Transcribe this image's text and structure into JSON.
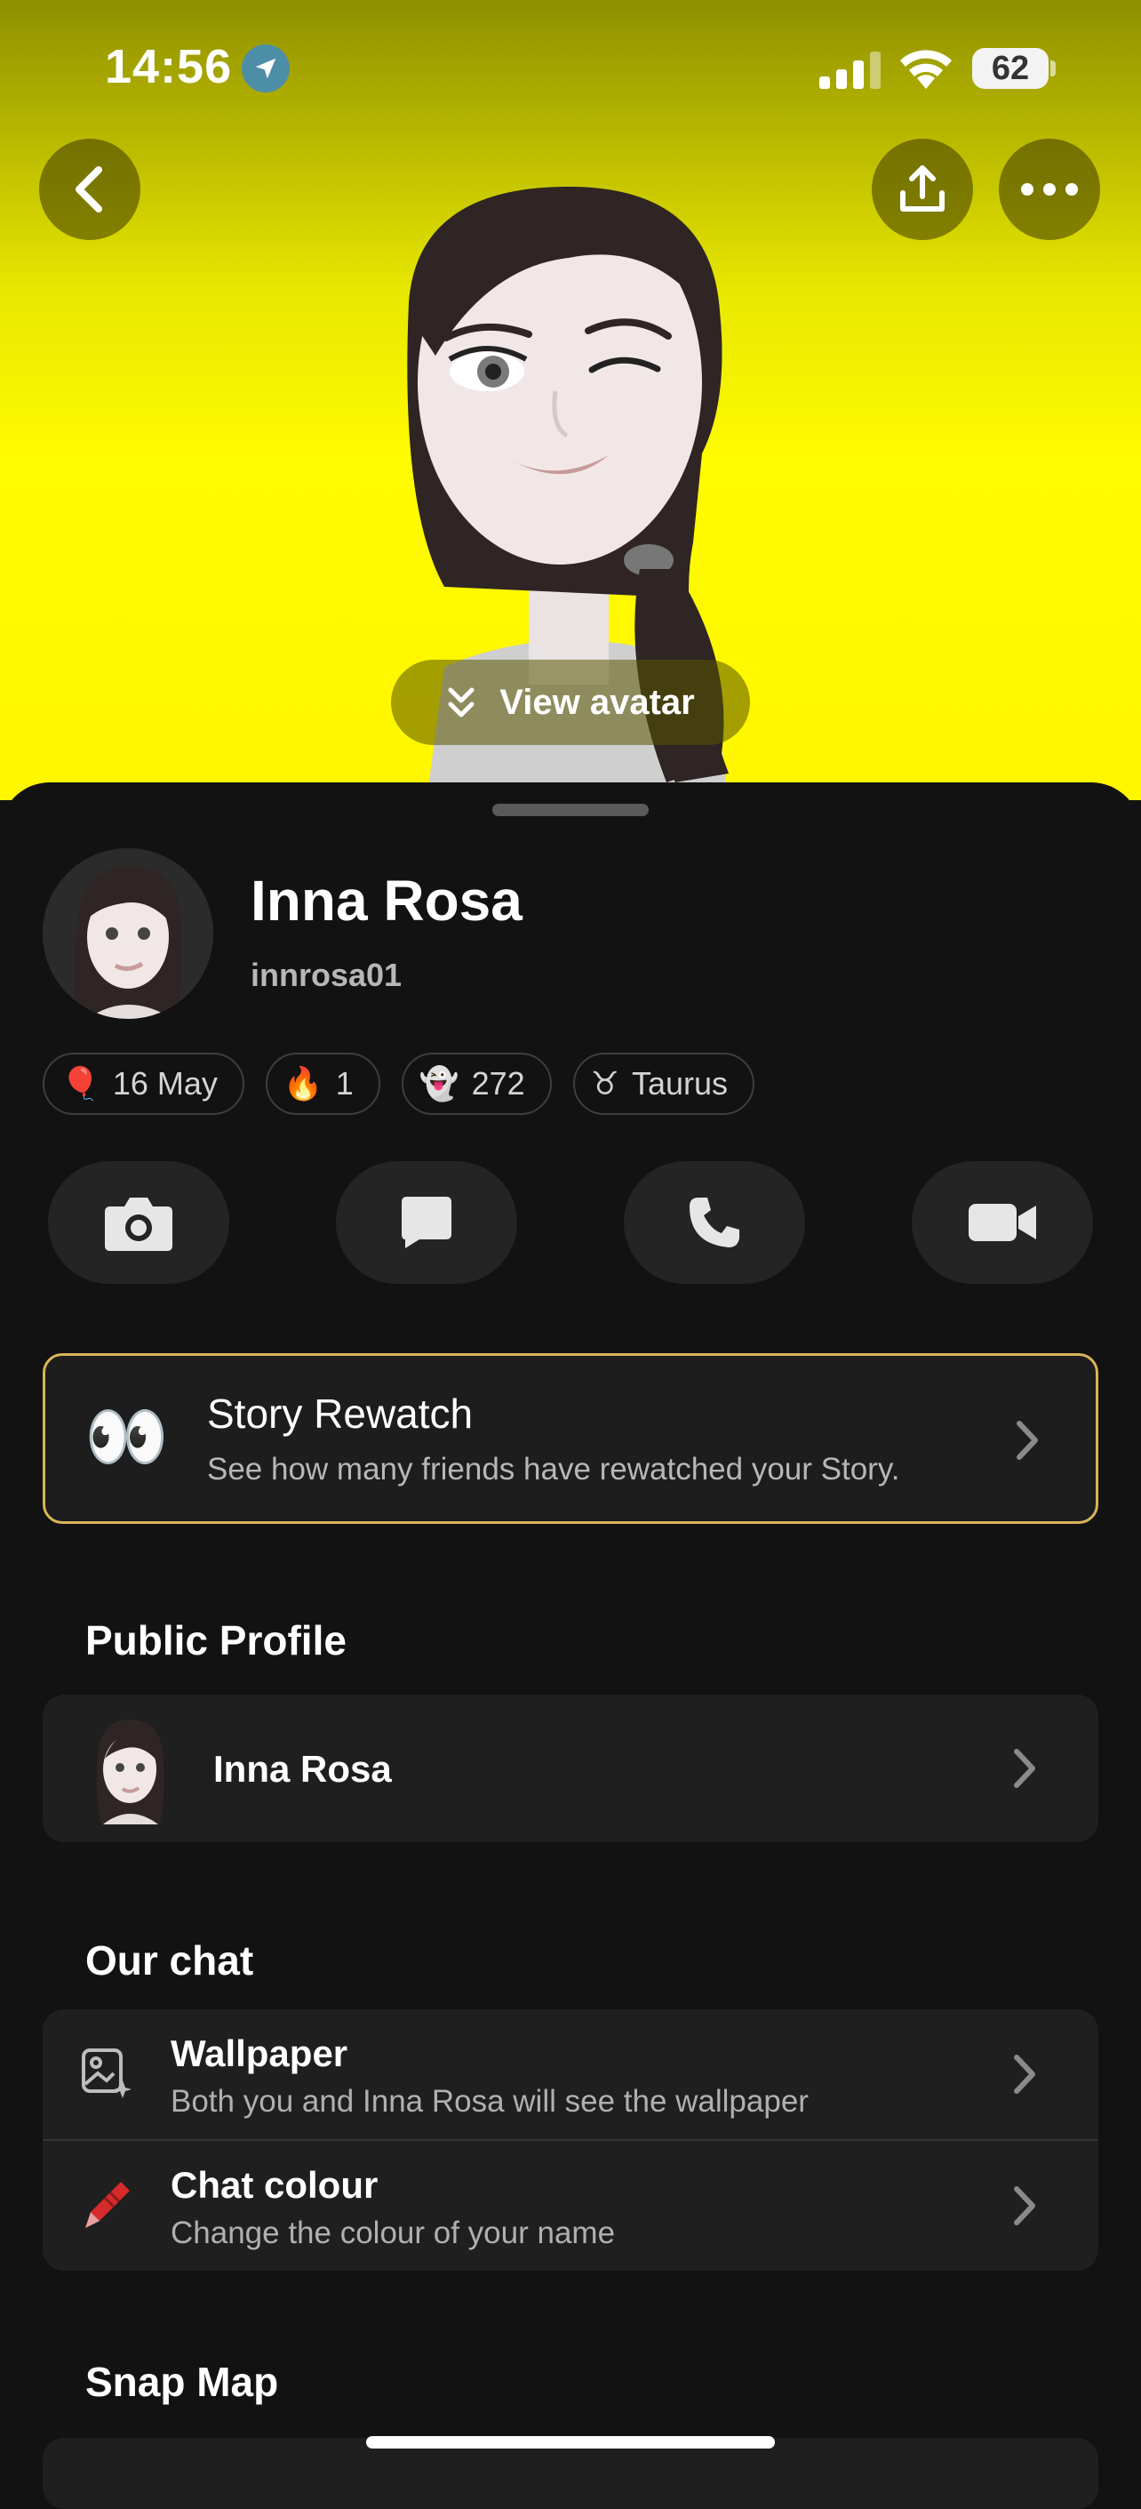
{
  "status_bar": {
    "time": "14:56",
    "battery": "62"
  },
  "header": {
    "view_avatar_label": "View avatar"
  },
  "profile": {
    "name": "Inna Rosa",
    "username": "innrosa01",
    "chips": [
      {
        "icon": "balloon-icon",
        "emoji": "🎈",
        "label": "16 May"
      },
      {
        "icon": "fire-icon",
        "emoji": "🔥",
        "label": "1"
      },
      {
        "icon": "snapscore-icon",
        "emoji": "👻",
        "label": "272"
      },
      {
        "icon": "taurus-icon",
        "emoji": "♉",
        "label": "Taurus"
      }
    ]
  },
  "actions": [
    {
      "name": "camera-button",
      "icon": "camera-icon"
    },
    {
      "name": "chat-button",
      "icon": "chat-bubble-icon"
    },
    {
      "name": "call-button",
      "icon": "phone-icon"
    },
    {
      "name": "video-call-button",
      "icon": "video-camera-icon"
    }
  ],
  "story_rewatch": {
    "emoji": "👀",
    "title": "Story Rewatch",
    "subtitle": "See how many friends have rewatched your Story."
  },
  "public_profile": {
    "section_title": "Public Profile",
    "name": "Inna Rosa"
  },
  "our_chat": {
    "section_title": "Our chat",
    "items": [
      {
        "title": "Wallpaper",
        "subtitle": "Both you and Inna Rosa will see the wallpaper",
        "icon": "wallpaper-icon"
      },
      {
        "title": "Chat colour",
        "subtitle": "Change the colour of your name",
        "icon": "crayon-icon"
      }
    ]
  },
  "snap_map": {
    "section_title": "Snap Map"
  },
  "colors": {
    "accent_yellow": "#fffc00",
    "rewatch_border": "#d9b45a",
    "background": "#121212",
    "card": "#1f1f1f"
  }
}
